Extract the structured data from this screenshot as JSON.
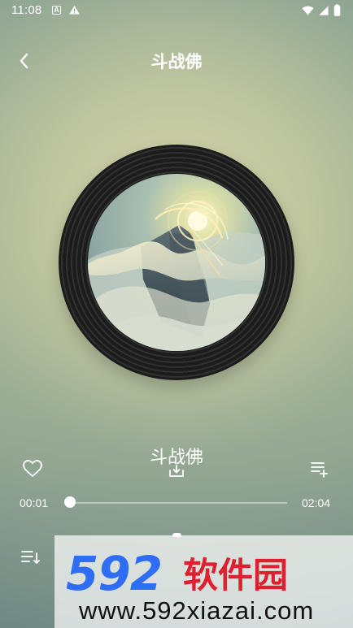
{
  "status_bar": {
    "time": "11:08"
  },
  "header": {
    "title": "斗战佛"
  },
  "player": {
    "song_title": "斗战佛",
    "current_time": "00:01",
    "duration": "02:04",
    "progress_fraction": 0.008
  },
  "watermark": {
    "logo_text": "592软件园",
    "url": "www.592xiazai.com"
  },
  "colors": {
    "accent": "#ffffff",
    "watermark_blue": "#2f6df6",
    "watermark_red": "#df1f2d"
  }
}
